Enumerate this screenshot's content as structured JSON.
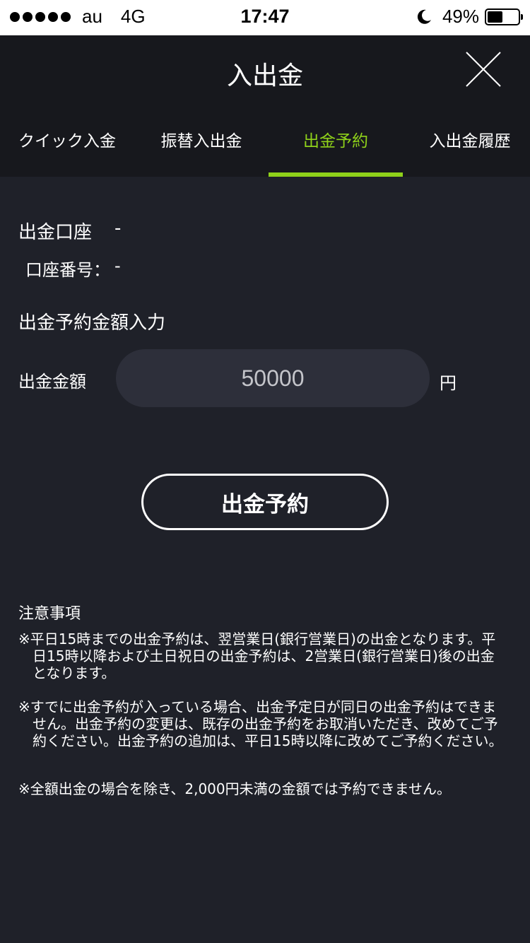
{
  "status_bar": {
    "carrier": "au",
    "network": "4G",
    "time": "17:47",
    "battery_percent": "49%",
    "battery_level": 0.49
  },
  "header": {
    "title": "入出金",
    "close_icon": "close-icon"
  },
  "tabs": [
    {
      "label": "クイック入金",
      "active": false
    },
    {
      "label": "振替入出金",
      "active": false
    },
    {
      "label": "出金予約",
      "active": true
    },
    {
      "label": "入出金履歴",
      "active": false
    }
  ],
  "account": {
    "label": "出金口座",
    "value": "-",
    "number_label": "口座番号：",
    "number_value": "-"
  },
  "form": {
    "section_title": "出金予約金額入力",
    "amount_label": "出金金額",
    "amount_value": "50000",
    "currency": "円",
    "submit_label": "出金予約"
  },
  "notes": {
    "title": "注意事項",
    "items": [
      "※平日15時までの出金予約は、翌営業日(銀行営業日)の出金となります。平日15時以降および土日祝日の出金予約は、2営業日(銀行営業日)後の出金となります。",
      "※すでに出金予約が入っている場合、出金予定日が同日の出金予約はできません。出金予約の変更は、既存の出金予約をお取消いただき、改めてご予約ください。出金予約の追加は、平日15時以降に改めてご予約ください。",
      "※全額出金の場合を除き、2,000円未満の金額では予約できません。"
    ]
  },
  "colors": {
    "accent": "#8fd11a",
    "background": "#1f2129",
    "header_background": "#17181d",
    "input_background": "#2d2f3a"
  }
}
